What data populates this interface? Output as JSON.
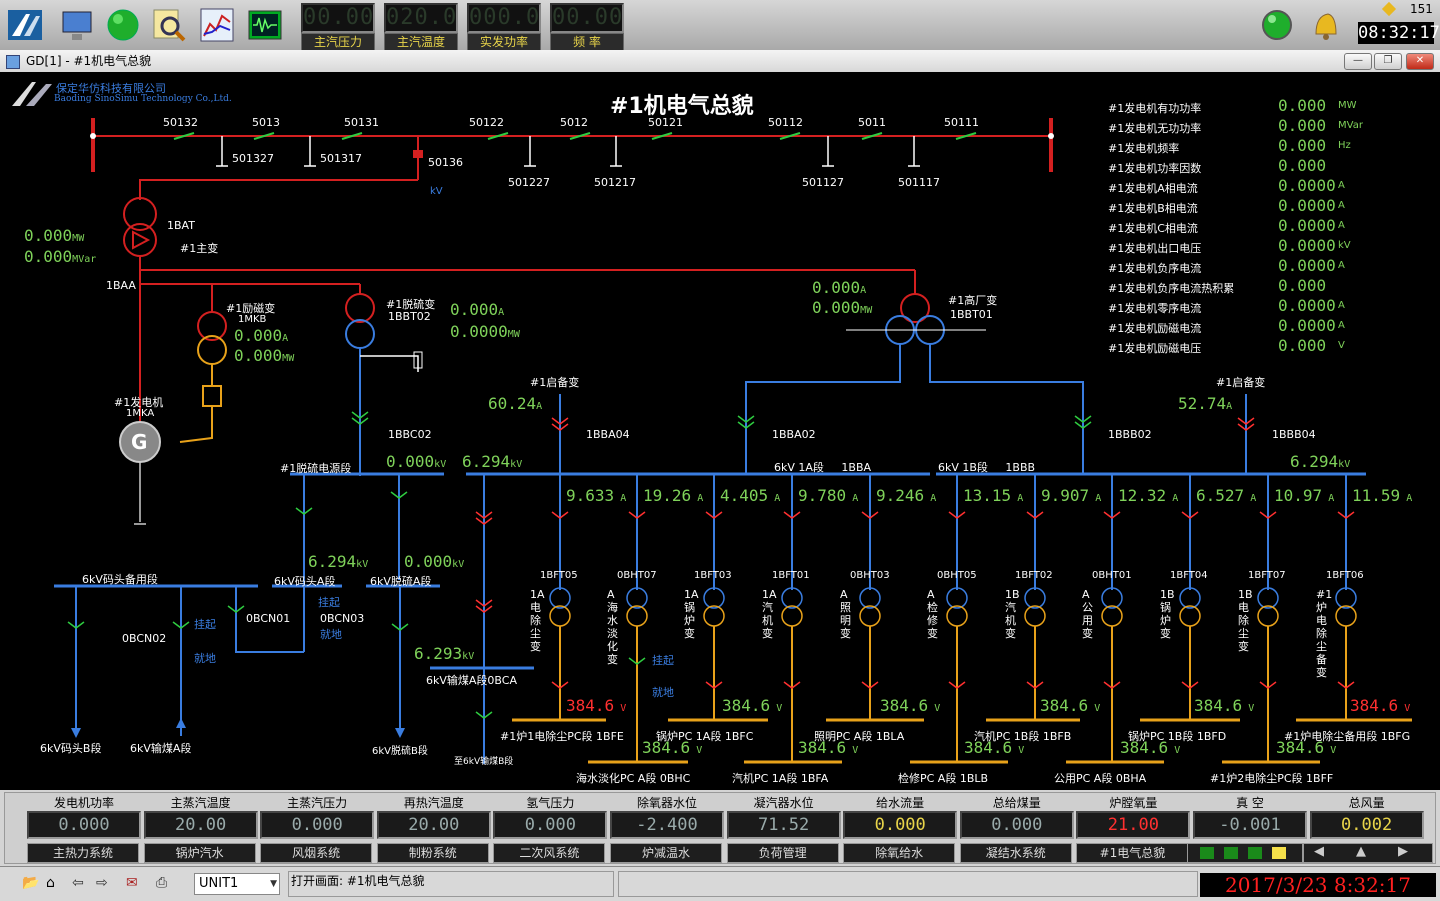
{
  "topbar": {
    "meters": [
      {
        "value": "00.00",
        "label": "主汽压力"
      },
      {
        "value": "020.0",
        "label": "主汽温度"
      },
      {
        "value": "000.0",
        "label": "实发功率"
      },
      {
        "value": "00.00",
        "label": "频 率"
      }
    ],
    "counter": "151",
    "clock": "08:32:17"
  },
  "window": {
    "title": "GD[1] - #1机电气总貌"
  },
  "company": {
    "name_cn": "保定华仿科技有限公司",
    "name_en": "Baoding SinoSimu Technology Co.,Ltd."
  },
  "diagram": {
    "title": "#1机电气总貌",
    "kv_unit": "kV",
    "main_bus_switches": [
      "50132",
      "5013",
      "50131",
      "50122",
      "5012",
      "50121",
      "50112",
      "5011",
      "50111"
    ],
    "ground_switches": [
      "501327",
      "501317",
      "50136",
      "501227",
      "501217",
      "501127",
      "501117"
    ],
    "generator_readings": [
      {
        "label": "#1发电机有功功率",
        "value": "0.000",
        "unit": "MW"
      },
      {
        "label": "#1发电机无功功率",
        "value": "0.000",
        "unit": "MVar"
      },
      {
        "label": "#1发电机频率",
        "value": "0.000",
        "unit": "Hz"
      },
      {
        "label": "#1发电机功率因数",
        "value": "0.000",
        "unit": ""
      },
      {
        "label": "#1发电机A相电流",
        "value": "0.0000",
        "unit": "A"
      },
      {
        "label": "#1发电机B相电流",
        "value": "0.0000",
        "unit": "A"
      },
      {
        "label": "#1发电机C相电流",
        "value": "0.0000",
        "unit": "A"
      },
      {
        "label": "#1发电机出口电压",
        "value": "0.0000",
        "unit": "kV"
      },
      {
        "label": "#1发电机负序电流",
        "value": "0.0000",
        "unit": "A"
      },
      {
        "label": "#1发电机负序电流热积累",
        "value": "0.000",
        "unit": ""
      },
      {
        "label": "#1发电机零序电流",
        "value": "0.0000",
        "unit": "A"
      },
      {
        "label": "#1发电机励磁电流",
        "value": "0.0000",
        "unit": "A"
      },
      {
        "label": "#1发电机励磁电压",
        "value": "0.000",
        "unit": "V"
      }
    ],
    "main_transformer": {
      "name": "#1主变",
      "code": "1BAT",
      "mw": "0.000",
      "mw_unit": "MW",
      "mvar": "0.000",
      "mvar_unit": "MVar"
    },
    "bus_1baa": "1BAA",
    "excitation": {
      "name": "#1励磁变",
      "code": "1MKB",
      "a": "0.000",
      "a_unit": "A",
      "mw": "0.000",
      "mw_unit": "MW"
    },
    "desulf": {
      "name": "#1脱硫变",
      "code": "1BBT02",
      "a": "0.000",
      "a_unit": "A",
      "mw": "0.0000",
      "mw_unit": "MW"
    },
    "house": {
      "name": "#1高厂变",
      "code": "1BBT01",
      "a": "0.000",
      "a_unit": "A",
      "mw": "0.000",
      "mw_unit": "MW"
    },
    "generator": {
      "name": "#1发电机",
      "code": "1MKA",
      "symbol": "G"
    },
    "standby": [
      {
        "name": "#1启备变",
        "a": "60.24",
        "a_unit": "A",
        "code": "1BBA04"
      },
      {
        "name": "#1启备变",
        "a": "52.74",
        "a_unit": "A",
        "code": "1BBB04"
      }
    ],
    "codes": {
      "bbc02": "1BBC02",
      "bba02": "1BBA02",
      "bbb02": "1BBB02"
    },
    "desulf_bus": {
      "name": "#1脱硫电源段",
      "kv": "0.000",
      "kv2": "6.294"
    },
    "bus_1a": {
      "name": "6kV 1A段",
      "code": "1BBA"
    },
    "bus_1b": {
      "name": "6kV 1B段",
      "code": "1BBB",
      "kv": "6.294"
    },
    "feeder_currents": [
      "9.633",
      "19.26",
      "4.405",
      "9.780",
      "9.246",
      "13.15",
      "9.907",
      "12.32",
      "6.527",
      "10.97",
      "11.59"
    ],
    "transformers": [
      {
        "code": "1BFT05",
        "name": "1A电除尘变"
      },
      {
        "code": "0BHT07",
        "name": "A海水淡化变"
      },
      {
        "code": "1BFT03",
        "name": "1A锅炉变"
      },
      {
        "code": "1BFT01",
        "name": "1A汽机变"
      },
      {
        "code": "0BHT03",
        "name": "A照明变"
      },
      {
        "code": "0BHT05",
        "name": "A检修变"
      },
      {
        "code": "1BFT02",
        "name": "1B汽机变"
      },
      {
        "code": "0BHT01",
        "name": "A公用变"
      },
      {
        "code": "1BFT04",
        "name": "1B锅炉变"
      },
      {
        "code": "1BFT07",
        "name": "1B电除尘变"
      },
      {
        "code": "1BFT06",
        "name": "#1炉电除尘备变"
      }
    ],
    "lv_voltage": "384.6",
    "lv_buses": [
      {
        "name": "#1炉1电除尘PC段 1BFE"
      },
      {
        "name": "海水淡化PC A段 0BHC"
      },
      {
        "name": "锅炉PC 1A段 1BFC"
      },
      {
        "name": "汽机PC 1A段 1BFA"
      },
      {
        "name": "照明PC A段 1BLA"
      },
      {
        "name": "检修PC A段 1BLB"
      },
      {
        "name": "汽机PC 1B段 1BFB"
      },
      {
        "name": "公用PC A段 0BHA"
      },
      {
        "name": "锅炉PC 1B段 1BFD"
      },
      {
        "name": "#1炉2电除尘PC段 1BFF"
      },
      {
        "name": "#1炉电除尘备用段 1BFG"
      }
    ],
    "left_buses": {
      "dock_standby": "6kV码头备用段",
      "dock_a": "6kV码头A段",
      "desulf_a": "6kV脱硫A段",
      "coal_a_label": "6kV输煤A段0BCA",
      "dock_b": "6kV码头B段",
      "coal_a2": "6kV输煤A段",
      "desulf_b": "6kV脱硫B段",
      "coal_b": "至6kV输煤B段",
      "v1": "6.294",
      "v2": "0.000",
      "v3": "6.293",
      "cn01": "0BCN01",
      "cn02": "0BCN02",
      "cn03": "0BCN03",
      "raise": "挂起",
      "ground": "就地"
    }
  },
  "bottom": {
    "cells": [
      {
        "label": "发电机功率",
        "value": "0.000",
        "color": "#9aa"
      },
      {
        "label": "主蒸汽温度",
        "value": "20.00",
        "color": "#9aa"
      },
      {
        "label": "主蒸汽压力",
        "value": "0.000",
        "color": "#9aa"
      },
      {
        "label": "再热汽温度",
        "value": "20.00",
        "color": "#9aa"
      },
      {
        "label": "氢气压力",
        "value": "0.000",
        "color": "#9aa"
      },
      {
        "label": "除氧器水位",
        "value": "-2.400",
        "color": "#9aa"
      },
      {
        "label": "凝汽器水位",
        "value": "71.52",
        "color": "#9aa"
      },
      {
        "label": "给水流量",
        "value": "0.000",
        "color": "#e8d44a"
      },
      {
        "label": "总给煤量",
        "value": "0.000",
        "color": "#9aa"
      },
      {
        "label": "炉膛氧量",
        "value": "21.00",
        "color": "#ff3030"
      },
      {
        "label": "真 空",
        "value": "-0.001",
        "color": "#9aa"
      },
      {
        "label": "总风量",
        "value": "0.002",
        "color": "#e8d44a"
      }
    ],
    "nav": [
      "主热力系统",
      "锅炉汽水",
      "风烟系统",
      "制粉系统",
      "二次风系统",
      "炉减温水",
      "负荷管理",
      "除氧给水",
      "凝结水系统",
      "#1电气总貌"
    ],
    "unit": "UNIT1",
    "status_text": "打开画面: #1机电气总貌",
    "datetime": "2017/3/23 8:32:17"
  }
}
